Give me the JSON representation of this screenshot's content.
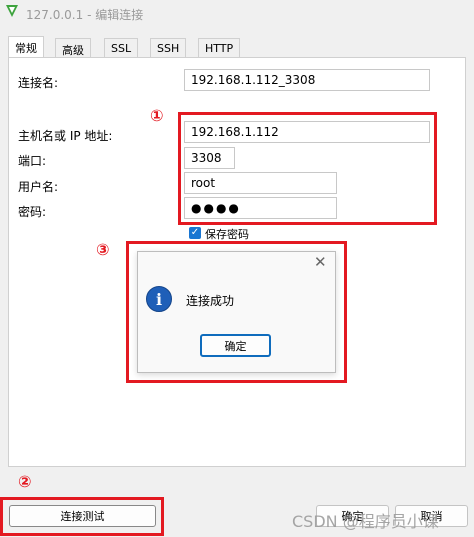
{
  "window": {
    "title": "127.0.0.1 - 编辑连接"
  },
  "tabs": [
    {
      "label": "常规"
    },
    {
      "label": "高级"
    },
    {
      "label": "SSL"
    },
    {
      "label": "SSH"
    },
    {
      "label": "HTTP"
    }
  ],
  "form": {
    "conn_name_label": "连接名:",
    "conn_name_value": "192.168.1.112_3308",
    "host_label": "主机名或 IP 地址:",
    "host_value": "192.168.1.112",
    "port_label": "端口:",
    "port_value": "3308",
    "user_label": "用户名:",
    "user_value": "root",
    "password_label": "密码:",
    "password_value": "●●●●",
    "save_password_label": "保存密码"
  },
  "dialog": {
    "message": "连接成功",
    "ok_label": "确定"
  },
  "buttons": {
    "test_label": "连接测试",
    "ok_label": "确定",
    "cancel_label": "取消"
  },
  "annotations": {
    "one": "①",
    "two": "②",
    "three": "③",
    "color": "#e31921"
  },
  "watermark": "CSDN @程序员小课"
}
